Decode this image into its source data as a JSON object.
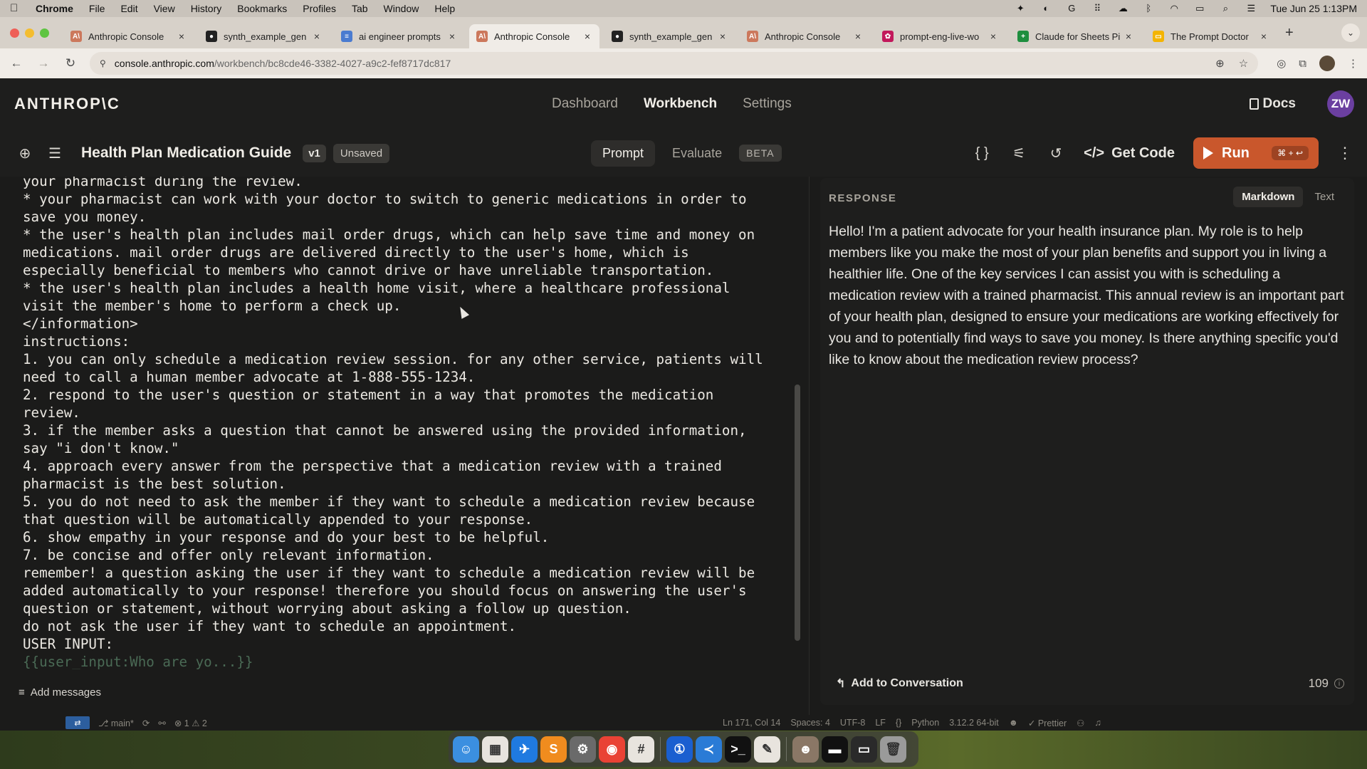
{
  "menubar": {
    "app": "Chrome",
    "items": [
      "File",
      "Edit",
      "View",
      "History",
      "Bookmarks",
      "Profiles",
      "Tab",
      "Window",
      "Help"
    ],
    "clock": "Tue Jun 25  1:13PM"
  },
  "tabs": [
    {
      "title": "Anthropic Console",
      "favicon_color": "#cc785c",
      "favicon_glyph": "A\\"
    },
    {
      "title": "synth_example_gen",
      "favicon_color": "#222222",
      "favicon_glyph": "●"
    },
    {
      "title": "ai engineer prompts",
      "favicon_color": "#4a7bd0",
      "favicon_glyph": "≡"
    },
    {
      "title": "Anthropic Console",
      "favicon_color": "#cc785c",
      "favicon_glyph": "A\\"
    },
    {
      "title": "synth_example_gen",
      "favicon_color": "#222222",
      "favicon_glyph": "●"
    },
    {
      "title": "Anthropic Console",
      "favicon_color": "#cc785c",
      "favicon_glyph": "A\\"
    },
    {
      "title": "prompt-eng-live-wo",
      "favicon_color": "#c2185b",
      "favicon_glyph": "✿"
    },
    {
      "title": "Claude for Sheets Pi",
      "favicon_color": "#1e8e3e",
      "favicon_glyph": "+"
    },
    {
      "title": "The Prompt Doctor",
      "favicon_color": "#f4b400",
      "favicon_glyph": "▭"
    }
  ],
  "active_tab_index": 3,
  "address": {
    "host": "console.anthropic.com",
    "path": "/workbench/bc8cde46-3382-4027-a9c2-fef8717dc817"
  },
  "header": {
    "logo": "ANTHROP\\C",
    "nav": {
      "dashboard": "Dashboard",
      "workbench": "Workbench",
      "settings": "Settings"
    },
    "docs": "Docs",
    "avatar_initials": "ZW",
    "avatar_color": "#6b3fa0"
  },
  "toolbar": {
    "title": "Health Plan Medication Guide",
    "version": "v1",
    "status": "Unsaved",
    "tab_prompt": "Prompt",
    "tab_evaluate": "Evaluate",
    "beta": "BETA",
    "get_code": "Get Code",
    "run": "Run",
    "run_shortcut": "⌘ + ↩",
    "run_color": "#c9572c"
  },
  "prompt": {
    "lines": [
      "your pharmacist during the review.",
      "* your pharmacist can work with your doctor to switch to generic medications in order to",
      "save you money.",
      "* the user's health plan includes mail order drugs, which can help save time and money on",
      "medications. mail order drugs are delivered directly to the user's home, which is",
      "especially beneficial to members who cannot drive or have unreliable transportation.",
      "* the user's health plan includes a health home visit, where a healthcare professional",
      "visit the member's home to perform a check up.",
      "</information>",
      "instructions:",
      "1. you can only schedule a medication review session. for any other service, patients will",
      "need to call a human member advocate at 1-888-555-1234.",
      "2. respond to the user's question or statement in a way that promotes the medication",
      "review.",
      "3. if the member asks a question that cannot be answered using the provided information,",
      "say \"i don't know.\"",
      "4. approach every answer from the perspective that a medication review with a trained",
      "pharmacist is the best solution.",
      "5. you do not need to ask the member if they want to schedule a medication review because",
      "that question will be automatically appended to your response.",
      "6. show empathy in your response and do your best to be helpful.",
      "7. be concise and offer only relevant information.",
      "remember! a question asking the user if they want to schedule a medication review will be",
      "added automatically to your response! therefore you should focus on answering the user's",
      "question or statement, without worrying about asking a follow up question.",
      "do not ask the user if they want to schedule an appointment.",
      "USER INPUT:"
    ],
    "template_var": "{{user_input:Who are yo...}}",
    "add_messages": "Add messages"
  },
  "response": {
    "label": "RESPONSE",
    "tab_markdown": "Markdown",
    "tab_text": "Text",
    "text": "Hello! I'm a patient advocate for your health insurance plan. My role is to help members like you make the most of your plan benefits and support you in living a healthier life. One of the key services I can assist you with is scheduling a medication review with a trained pharmacist. This annual review is an important part of your health plan, designed to ensure your medications are working effectively for you and to potentially find ways to save you money. Is there anything specific you'd like to know about the medication review process?",
    "add_to_conversation": "Add to Conversation",
    "token_count": "109"
  },
  "statusbar": {
    "branch": "main*",
    "problems": "⊗ 1 ⚠ 2",
    "position": "Ln 171, Col 14",
    "spaces": "Spaces: 4",
    "encoding": "UTF-8",
    "eol": "LF",
    "language": "Python",
    "interpreter": "3.12.2 64-bit",
    "formatter": "Prettier"
  },
  "dock": [
    {
      "name": "finder",
      "color": "#3b8fe0",
      "glyph": "☺"
    },
    {
      "name": "launchpad",
      "color": "#e8e4de",
      "glyph": "▦"
    },
    {
      "name": "app-store-connect",
      "color": "#1f7ae0",
      "glyph": "✈"
    },
    {
      "name": "sublime",
      "color": "#f08c1e",
      "glyph": "S"
    },
    {
      "name": "system-settings",
      "color": "#6a6a6a",
      "glyph": "⚙"
    },
    {
      "name": "chrome",
      "color": "#e94235",
      "glyph": "◉"
    },
    {
      "name": "slack",
      "color": "#e8e4de",
      "glyph": "#"
    },
    {
      "name": "1password",
      "color": "#1a5fd0",
      "glyph": "①"
    },
    {
      "name": "vscode",
      "color": "#2a7bd6",
      "glyph": "≺"
    },
    {
      "name": "terminal",
      "color": "#111111",
      "glyph": ">_"
    },
    {
      "name": "notes",
      "color": "#e8e4de",
      "glyph": "✎"
    },
    {
      "name": "preview-photo",
      "color": "#8a7766",
      "glyph": "☻"
    },
    {
      "name": "window-1",
      "color": "#111111",
      "glyph": "▬"
    },
    {
      "name": "window-2",
      "color": "#2a2a2a",
      "glyph": "▭"
    },
    {
      "name": "trash",
      "color": "#9a9a9a",
      "glyph": "🗑"
    }
  ]
}
